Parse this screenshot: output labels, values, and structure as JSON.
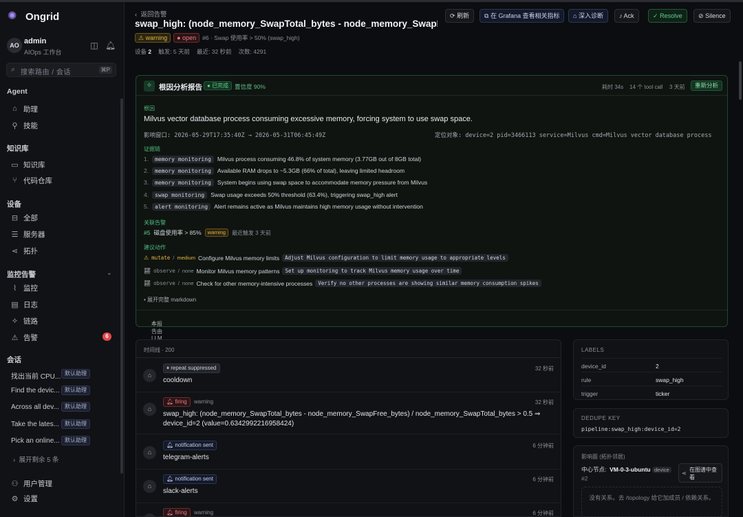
{
  "app": {
    "brand": "Ongrid",
    "brand_icon": "ongrid-logo-icon"
  },
  "user": {
    "initials": "AO",
    "name": "admin",
    "role": "AIOps 工作台"
  },
  "search": {
    "placeholder": "搜索路由 / 会话",
    "shortcut": "⌘P"
  },
  "sidebar": {
    "agent": {
      "title": "Agent",
      "items": [
        {
          "label": "助理",
          "icon": "bot-icon"
        },
        {
          "label": "技能",
          "icon": "wrench-icon"
        }
      ]
    },
    "kb": {
      "title": "知识库",
      "items": [
        {
          "label": "知识库",
          "icon": "book-icon"
        },
        {
          "label": "代码仓库",
          "icon": "git-branch-icon"
        }
      ]
    },
    "devices": {
      "title": "设备",
      "items": [
        {
          "label": "全部",
          "icon": "hard-drive-icon"
        },
        {
          "label": "服务器",
          "icon": "server-icon"
        },
        {
          "label": "拓扑",
          "icon": "share-icon"
        }
      ]
    },
    "monitor": {
      "title": "监控告警",
      "items": [
        {
          "label": "监控",
          "icon": "chart-icon"
        },
        {
          "label": "日志",
          "icon": "file-icon"
        },
        {
          "label": "链路",
          "icon": "workflow-icon"
        },
        {
          "label": "告警",
          "icon": "siren-icon",
          "badge": "6"
        }
      ]
    },
    "convs": {
      "title": "会话",
      "items": [
        {
          "label": "找出当前 CPU...",
          "tag": "默认助理"
        },
        {
          "label": "Find the devic...",
          "tag": "默认助理"
        },
        {
          "label": "Across all dev...",
          "tag": "默认助理"
        },
        {
          "label": "Take the lates...",
          "tag": "默认助理"
        },
        {
          "label": "Pick an online...",
          "tag": "默认助理"
        }
      ],
      "more": "展开剩余 5 条"
    },
    "footer": [
      {
        "label": "用户管理",
        "icon": "users-icon"
      },
      {
        "label": "设置",
        "icon": "gear-icon"
      }
    ]
  },
  "header": {
    "back": "返回告警",
    "title": "swap_high: (node_memory_SwapTotal_bytes - node_memory_SwapFree_byte...",
    "severity": "warning",
    "status": "open",
    "rule_desc": "#6 · Swap 使用率 > 50% (swap_high)",
    "meta": {
      "device_label": "设备",
      "device": "2",
      "fired_label": "触发:",
      "fired": "5 天前",
      "last_label": "最近:",
      "last": "32 秒前",
      "count_label": "次数:",
      "count": "4291"
    },
    "actions": {
      "refresh": "刷新",
      "grafana": "在 Grafana 查看相关指标",
      "diagnose": "深入诊断",
      "ack": "Ack",
      "resolve": "Resolve",
      "silence": "Silence"
    }
  },
  "rca": {
    "title": "根因分析报告",
    "status": "已完成",
    "confidence": "置信度 90%",
    "duration": "耗时 34s",
    "tool_calls": "14 个 tool call",
    "ago": "3 天前",
    "regen": "重新分析",
    "root_label": "根因",
    "root": "Milvus vector database process consuming excessive memory, forcing system to use swap space.",
    "window": "影响窗口: 2026-05-29T17:35:40Z → 2026-05-31T06:45:49Z",
    "target": "定位对象: device=2 pid=3466113 service=Milvus cmd=Milvus vector database process",
    "chain_label": "证据链",
    "chain": [
      {
        "n": "1.",
        "tag": "memory monitoring",
        "text": "Milvus process consuming 46.8% of system memory (3.77GB out of 8GB total)"
      },
      {
        "n": "2.",
        "tag": "memory monitoring",
        "text": "Available RAM drops to ~5.3GB (66% of total), leaving limited headroom"
      },
      {
        "n": "3.",
        "tag": "memory monitoring",
        "text": "System begins using swap space to accommodate memory pressure from Milvus"
      },
      {
        "n": "4.",
        "tag": "swap monitoring",
        "text": "Swap usage exceeds 50% threshold (63.4%), triggering swap_high alert"
      },
      {
        "n": "5.",
        "tag": "alert monitoring",
        "text": "Alert remains active as Milvus maintains high memory usage without intervention"
      }
    ],
    "related_label": "关联告警",
    "related": {
      "num": "#5",
      "text": "磁盘使用率 > 85%",
      "sev": "warning",
      "time": "最近触发 3 天前"
    },
    "actions_label": "建议动作",
    "actions": [
      {
        "kind": "mutate",
        "level": "medium",
        "text": "Configure Milvus memory limits",
        "cmd": "Adjust Milvus configuration to limit memory usage to appropriate levels"
      },
      {
        "kind": "observe",
        "level": "none",
        "text": "Monitor Milvus memory patterns",
        "cmd": "Set up monitoring to track Milvus memory usage over time"
      },
      {
        "kind": "observe",
        "level": "none",
        "text": "Check for other memory-intensive processes",
        "cmd": "Verify no other processes are showing similar memory consumption spikes"
      }
    ],
    "expand": "• 展开完整 markdown",
    "footer": "本报告由 LLM 综合生成, 关键决策请二次核验。"
  },
  "timeline": {
    "title": "时间线 · 200",
    "events": [
      {
        "pill": "repeat suppressed",
        "pill_type": "rep",
        "sev": "",
        "time": "32 秒前",
        "text": "cooldown"
      },
      {
        "pill": "firing",
        "pill_type": "fire",
        "sev": "warning",
        "time": "32 秒前",
        "text": "swap_high: (node_memory_SwapTotal_bytes - node_memory_SwapFree_bytes) / node_memory_SwapTotal_bytes > 0.5 ⇒ device_id=2 (value=0.6342992216958424)"
      },
      {
        "pill": "notification sent",
        "pill_type": "note",
        "sev": "",
        "time": "6 分钟前",
        "text": "telegram-alerts"
      },
      {
        "pill": "notification sent",
        "pill_type": "note",
        "sev": "",
        "time": "6 分钟前",
        "text": "slack-alerts"
      },
      {
        "pill": "firing",
        "pill_type": "fire",
        "sev": "warning",
        "time": "6 分钟前",
        "text": ""
      }
    ]
  },
  "labels": {
    "title": "LABELS",
    "rows": [
      {
        "k": "device_id",
        "v": "2"
      },
      {
        "k": "rule",
        "v": "swap_high"
      },
      {
        "k": "trigger",
        "v": "ticker"
      }
    ]
  },
  "dedupe": {
    "title": "DEDUPE KEY",
    "value": "pipeline:swap_high:device_id=2"
  },
  "impact": {
    "title": "影响面 (拓扑邻居)",
    "center_label": "中心节点:",
    "node": "VM-0-3-ubuntu",
    "node_type": "device",
    "node_id": "#2",
    "graph_btn": "在图谱中查看",
    "empty": "没有关系。去 /topology 给它加成员 / 依赖关系。"
  }
}
